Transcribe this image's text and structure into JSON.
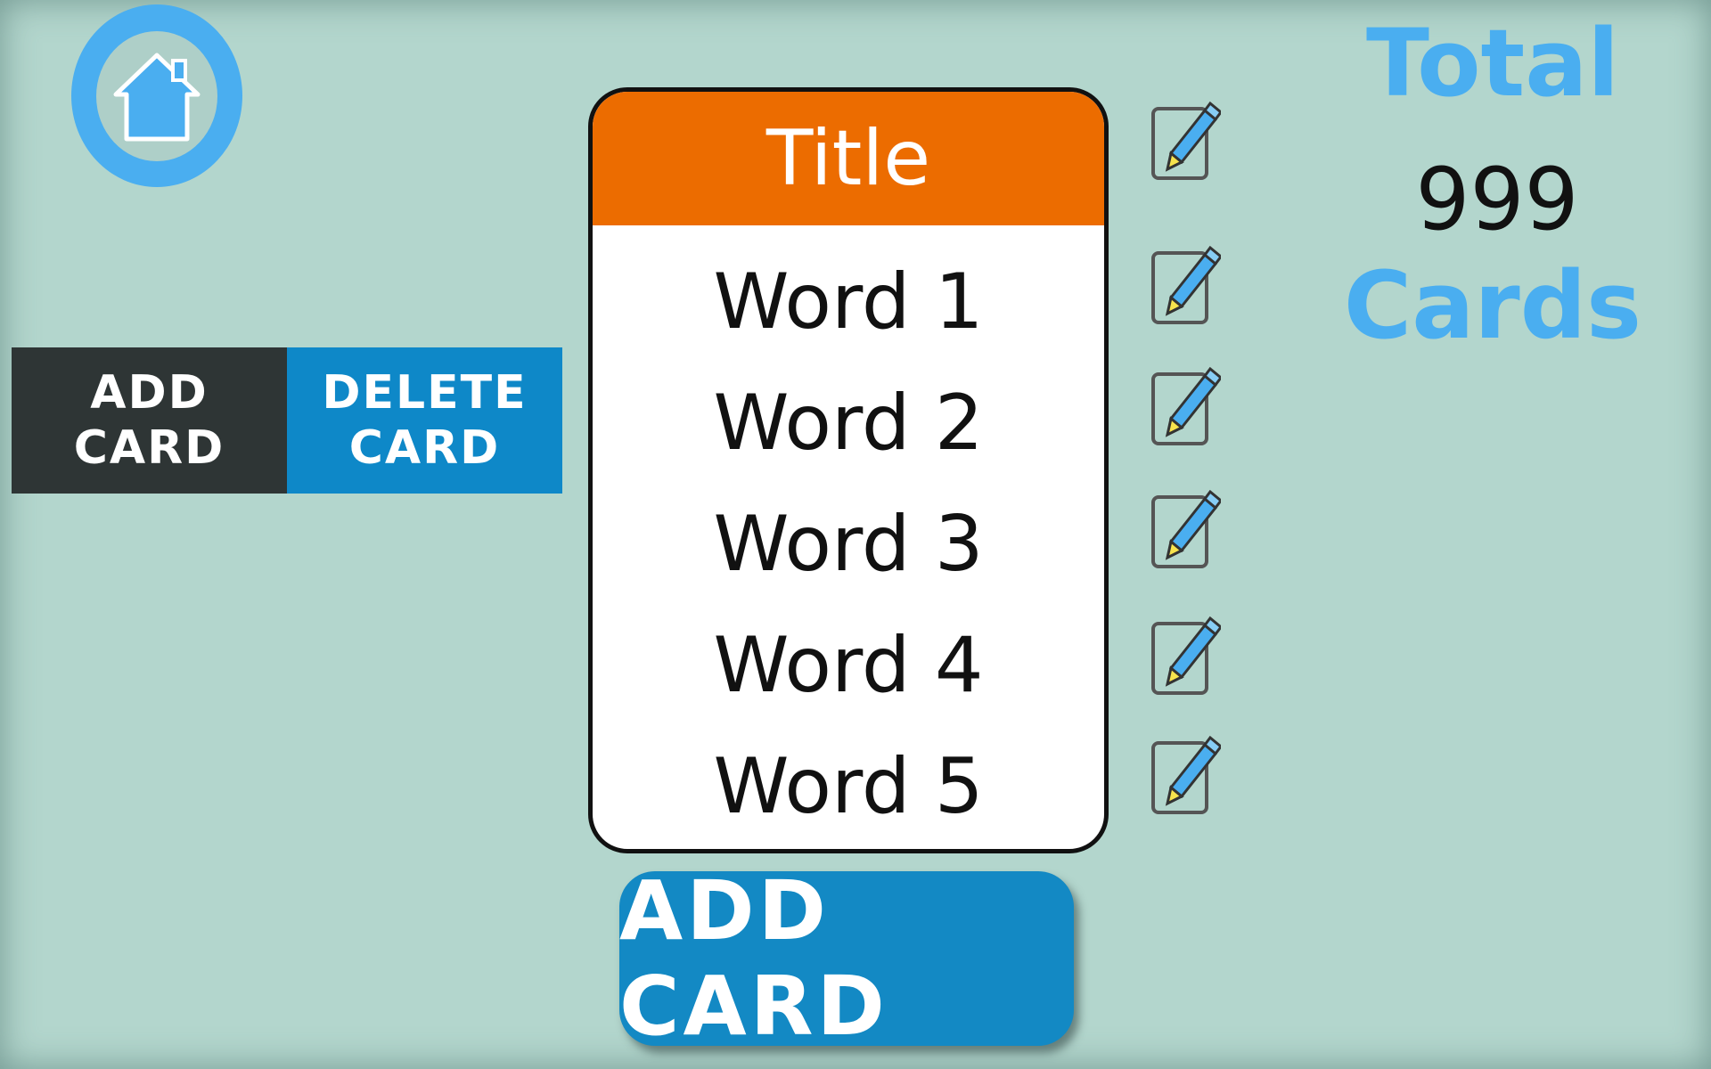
{
  "home": {
    "icon": "home-icon",
    "color": "#4aaef0"
  },
  "tabs": {
    "add": {
      "line1": "ADD",
      "line2": "CARD",
      "color": "#2e3535"
    },
    "delete": {
      "line1": "DELETE",
      "line2": "CARD",
      "color": "#0e88c8"
    }
  },
  "card": {
    "title": "Title",
    "header_color": "#ec6c00",
    "words": [
      "Word 1",
      "Word 2",
      "Word 3",
      "Word 4",
      "Word 5"
    ]
  },
  "edit_icon": "pencil-edit-icon",
  "add_card_button": {
    "label": "ADD CARD",
    "color": "#1389c4"
  },
  "total": {
    "label": "Total",
    "count": "999",
    "unit": "Cards",
    "accent": "#4aaef0"
  }
}
